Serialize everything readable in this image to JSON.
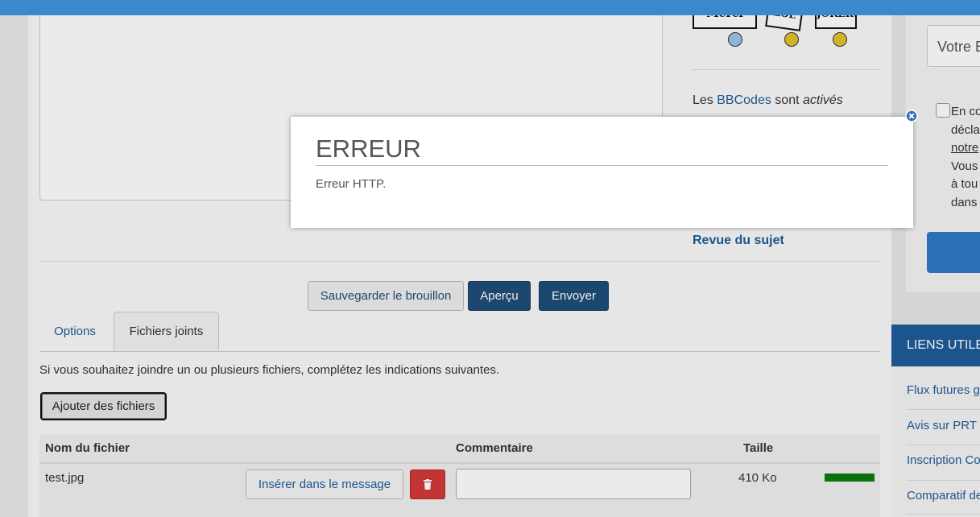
{
  "smilies": {
    "merci": "Merci",
    "lol": "LOL",
    "joker": "JOKER!"
  },
  "bbcodes": {
    "prefix": "Les ",
    "link": "BBCodes",
    "middle": " sont ",
    "status": "activés"
  },
  "revue_sujet": "Revue du sujet",
  "buttons": {
    "save_draft": "Sauvegarder le brouillon",
    "preview": "Aperçu",
    "submit": "Envoyer"
  },
  "tabs": [
    {
      "label": "Options"
    },
    {
      "label": "Fichiers joints"
    }
  ],
  "attachments": {
    "hint": "Si vous souhaitez joindre un ou plusieurs fichiers, complétez les indications suivantes.",
    "add_button": "Ajouter des fichiers",
    "columns": {
      "name": "Nom du fichier",
      "comment": "Commentaire",
      "size": "Taille"
    },
    "rows": [
      {
        "filename": "test.jpg",
        "insert_label": "Insérer dans le message",
        "comment": "",
        "size": "410 Ko",
        "progress": 1.0
      }
    ]
  },
  "sidebar": {
    "email_placeholder": "Votre E",
    "consent_lines": [
      "En co",
      "décla",
      "notre",
      "Vous",
      "à tou",
      "dans"
    ],
    "links_title": "LIENS UTILE",
    "links": [
      "Flux futures g",
      "Avis sur PRT",
      "Inscription Co",
      "Comparatif de"
    ]
  },
  "modal": {
    "title": "ERREUR",
    "message": "Erreur HTTP."
  },
  "colors": {
    "topbar": "#3a89cd",
    "primary": "#1f4f7a",
    "link": "#1f5c99",
    "danger": "#d43a3a",
    "progress": "#0c7a0c"
  }
}
